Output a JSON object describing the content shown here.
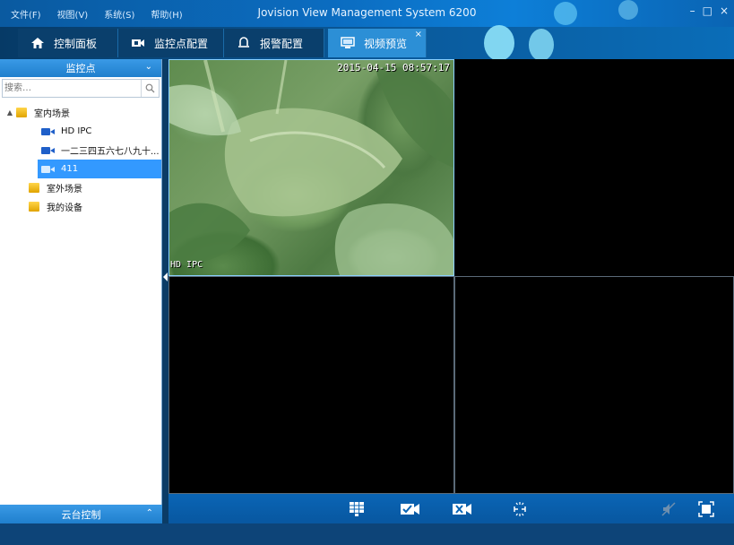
{
  "window": {
    "title": "Jovision View Management System 6200",
    "controls": {
      "minimize": "–",
      "maximize": "□",
      "close": "×"
    }
  },
  "menu": {
    "items": [
      {
        "label": "文件(F)"
      },
      {
        "label": "视图(V)"
      },
      {
        "label": "系统(S)"
      },
      {
        "label": "帮助(H)"
      }
    ]
  },
  "tabs": [
    {
      "label": "控制面板",
      "icon": "home-icon"
    },
    {
      "label": "监控点配置",
      "icon": "camera-config-icon"
    },
    {
      "label": "报警配置",
      "icon": "alarm-bell-icon"
    },
    {
      "label": "视频预览",
      "icon": "monitor-icon",
      "active": true,
      "close": "×"
    }
  ],
  "sidebar": {
    "header": "监控点",
    "search": {
      "placeholder": "搜索…",
      "value": ""
    },
    "tree": [
      {
        "label": "室内场景",
        "type": "folder",
        "expanded": true,
        "arrow": "▲"
      },
      {
        "label": "HD IPC",
        "type": "camera"
      },
      {
        "label": "一二三四五六七八九十...",
        "type": "camera"
      },
      {
        "label": "411",
        "type": "camera",
        "selected": true
      },
      {
        "label": "室外场景",
        "type": "folder"
      },
      {
        "label": "我的设备",
        "type": "folder"
      }
    ],
    "ptz_header": "云台控制",
    "chevron_down": "⌄",
    "chevron_up": "⌃"
  },
  "video": {
    "cells": [
      {
        "timestamp": "2015-04-15 08:57:17",
        "channel": "HD IPC",
        "active": true
      },
      {
        "timestamp": "",
        "channel": ""
      },
      {
        "timestamp": "",
        "channel": ""
      },
      {
        "timestamp": "",
        "channel": ""
      }
    ]
  },
  "toolbar": {
    "buttons": [
      {
        "icon": "grid-layout-icon"
      },
      {
        "icon": "start-all-video-icon"
      },
      {
        "icon": "stop-all-video-icon"
      },
      {
        "icon": "split-icon"
      },
      {
        "icon": "mute-icon"
      },
      {
        "icon": "fullscreen-icon"
      }
    ]
  },
  "colors": {
    "accent": "#2c8fd6",
    "selected": "#3399ff",
    "tab_bar": "#0a5a9c"
  }
}
